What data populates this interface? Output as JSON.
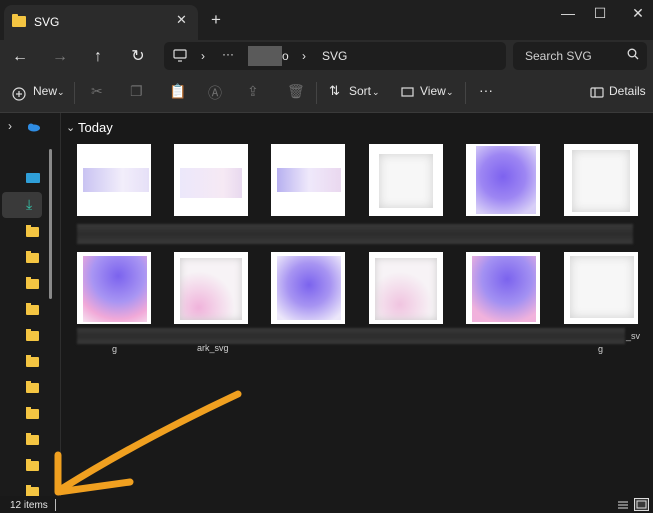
{
  "tab": {
    "title": "SVG",
    "close_glyph": "✕",
    "new_glyph": "+"
  },
  "window": {
    "minimize": "—",
    "maximize": "☐",
    "close": "✕"
  },
  "nav": {
    "back": "←",
    "forward": "→",
    "up": "↑",
    "refresh": "↻"
  },
  "address": {
    "sep1": "›",
    "ellipsis": "···",
    "partial": "o",
    "sep2": "›",
    "current": "SVG"
  },
  "search": {
    "placeholder": "Search SVG",
    "icon": "search-icon"
  },
  "toolbar": {
    "new_label": "New",
    "sort_label": "Sort",
    "view_label": "View",
    "more": "···",
    "details_label": "Details"
  },
  "content": {
    "group_label": "Today",
    "file_names": [
      "g",
      "ark_svg",
      "g",
      "_sv"
    ]
  },
  "status": {
    "item_count": "12 items"
  },
  "colors": {
    "accent": "#f0a020",
    "folder": "#f4c542",
    "background": "#191919"
  }
}
